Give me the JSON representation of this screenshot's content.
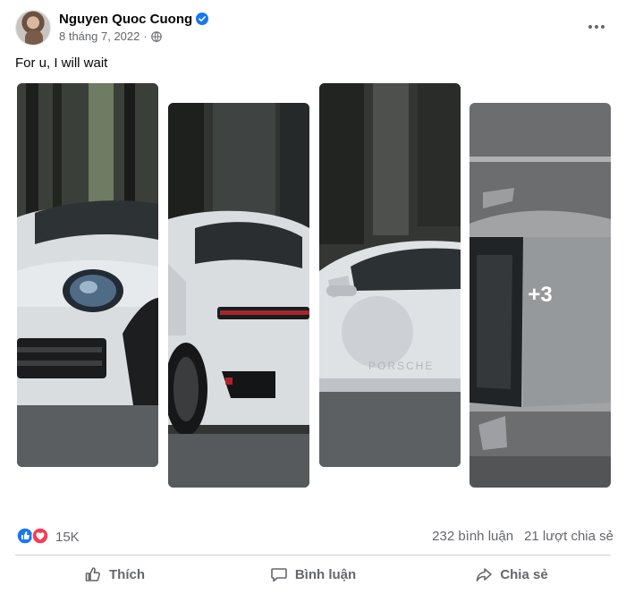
{
  "post": {
    "author_name": "Nguyen Quoc Cuong",
    "date": "8 tháng 7, 2022",
    "text": "For u, I will wait",
    "more_photos_label": "+3"
  },
  "icons": {
    "verified": "verified-badge-icon",
    "privacy": "globe-icon",
    "menu": "more-options-icon",
    "reactions": [
      "like-icon",
      "love-icon"
    ]
  },
  "engagement": {
    "reaction_count": "15K",
    "comments": "232 bình luận",
    "shares": "21 lượt chia sẻ"
  },
  "actions": {
    "like_label": "Thích",
    "comment_label": "Bình luận",
    "share_label": "Chia sẻ"
  },
  "colors": {
    "accent_blue": "#1877f2",
    "love_red": "#f33e58",
    "secondary_text": "#65676b"
  }
}
